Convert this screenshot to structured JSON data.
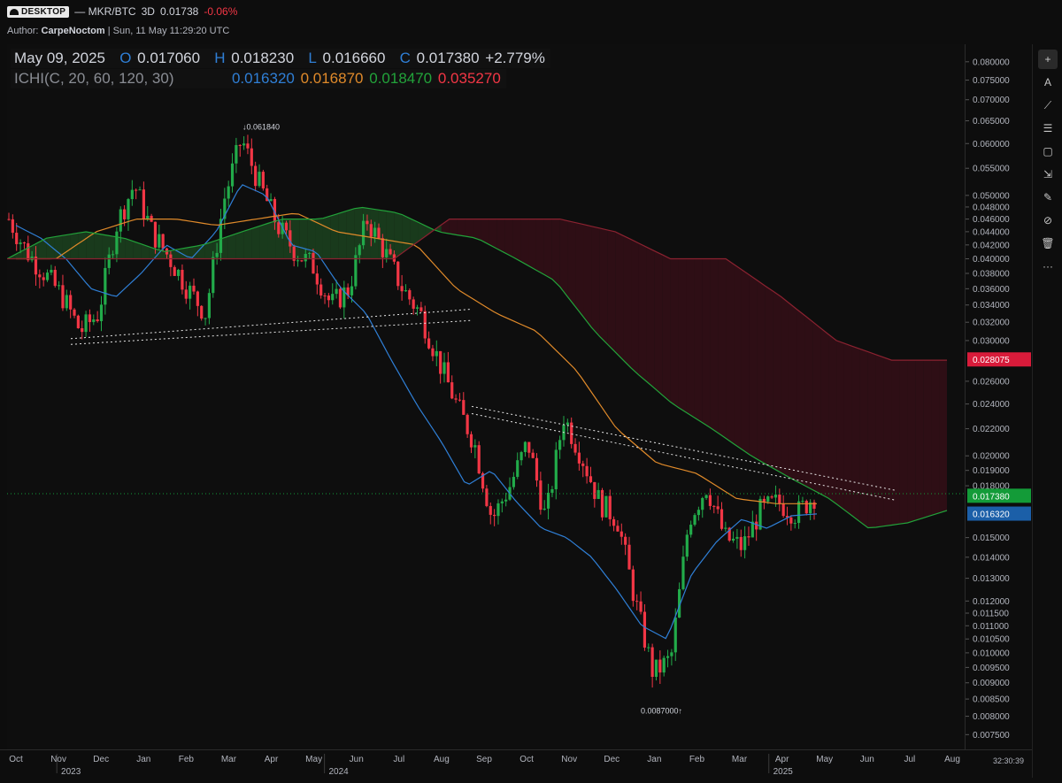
{
  "header": {
    "logo_label": "DESKTOP",
    "symbol": "— MKR/BTC",
    "interval": "3D",
    "last_price": "0.01738",
    "change": "-0.06%",
    "author_label": "Author:",
    "author_name": "CarpeNoctom",
    "timestamp": "| Sun, 11 May 11:29:20 UTC"
  },
  "legend": {
    "date": "May 09, 2025",
    "o_key": "O",
    "o_val": "0.017060",
    "h_key": "H",
    "h_val": "0.018230",
    "l_key": "L",
    "l_val": "0.016660",
    "c_key": "C",
    "c_val": "0.017380",
    "chg": "+2.779%",
    "indicator": "ICHI(C, 20, 60, 120, 30)",
    "ichi_vals": [
      "0.016320",
      "0.016870",
      "0.018470",
      "0.035270"
    ]
  },
  "colors": {
    "up": "#22ab4a",
    "down": "#f23645",
    "tenkan": "#2f7fd6",
    "kijun": "#e08a2a",
    "lead_a": "#22a33a",
    "lead_b": "#8b2230",
    "cloud_bull": "#1d4a22",
    "cloud_bear": "#3a0f18",
    "badge_green": "#139b38",
    "badge_blue": "#1b5fa8",
    "badge_red": "#d81b3a"
  },
  "chart_data": {
    "type": "candlestick",
    "title": "MKR/BTC 3D",
    "y_scale": "log",
    "ylim": [
      0.0073,
      0.083
    ],
    "y_ticks": [
      "0.080000",
      "0.075000",
      "0.070000",
      "0.065000",
      "0.060000",
      "0.055000",
      "0.050000",
      "0.048000",
      "0.046000",
      "0.044000",
      "0.042000",
      "0.040000",
      "0.038000",
      "0.036000",
      "0.034000",
      "0.032000",
      "0.030000",
      "0.026000",
      "0.024000",
      "0.022000",
      "0.020000",
      "0.019000",
      "0.018000",
      "0.015000",
      "0.014000",
      "0.013000",
      "0.012000",
      "0.011500",
      "0.011000",
      "0.010500",
      "0.010000",
      "0.009500",
      "0.009000",
      "0.008500",
      "0.008000",
      "0.007500"
    ],
    "x_ticks": [
      "Oct",
      "Nov",
      "Dec",
      "Jan",
      "Feb",
      "Mar",
      "Apr",
      "May",
      "Jun",
      "Jul",
      "Aug",
      "Sep",
      "Oct",
      "Nov",
      "Dec",
      "Jan",
      "Feb",
      "Mar",
      "Apr",
      "May",
      "Jun",
      "Jul",
      "Aug"
    ],
    "x_years": [
      {
        "label": "2023",
        "after": "Nov"
      },
      {
        "label": "2024",
        "after": "Jun"
      },
      {
        "label": "2025",
        "after": "Apr"
      }
    ],
    "close_path": [
      0.046,
      0.041,
      0.038,
      0.035,
      0.031,
      0.033,
      0.045,
      0.052,
      0.044,
      0.04,
      0.036,
      0.033,
      0.049,
      0.061,
      0.052,
      0.045,
      0.041,
      0.039,
      0.034,
      0.036,
      0.046,
      0.041,
      0.036,
      0.033,
      0.028,
      0.024,
      0.021,
      0.016,
      0.018,
      0.021,
      0.016,
      0.023,
      0.02,
      0.017,
      0.016,
      0.012,
      0.0093,
      0.0098,
      0.016,
      0.018,
      0.015,
      0.0145,
      0.0165,
      0.017,
      0.0163,
      0.01738
    ],
    "series": [
      {
        "name": "tenkan",
        "values": [
          0.045,
          0.043,
          0.04,
          0.036,
          0.035,
          0.038,
          0.042,
          0.04,
          0.044,
          0.052,
          0.05,
          0.042,
          0.041,
          0.036,
          0.033,
          0.028,
          0.024,
          0.021,
          0.018,
          0.019,
          0.017,
          0.0155,
          0.015,
          0.014,
          0.0125,
          0.011,
          0.0105,
          0.0132,
          0.0148,
          0.016,
          0.0155,
          0.0162,
          0.0163
        ]
      },
      {
        "name": "kijun",
        "values": [
          0.04,
          0.04,
          0.044,
          0.046,
          0.046,
          0.045,
          0.046,
          0.047,
          0.044,
          0.043,
          0.042,
          0.036,
          0.033,
          0.031,
          0.027,
          0.022,
          0.0195,
          0.0188,
          0.0172,
          0.0169,
          0.0169
        ]
      },
      {
        "name": "lead_a",
        "values": [
          0.04,
          0.043,
          0.044,
          0.043,
          0.041,
          0.042,
          0.044,
          0.046,
          0.046,
          0.048,
          0.047,
          0.044,
          0.043,
          0.04,
          0.037,
          0.031,
          0.027,
          0.024,
          0.022,
          0.02,
          0.0185,
          0.0172,
          0.0155,
          0.0158,
          0.0165
        ]
      },
      {
        "name": "lead_b",
        "values": [
          0.04,
          0.04,
          0.04,
          0.04,
          0.04,
          0.04,
          0.04,
          0.04,
          0.046,
          0.046,
          0.046,
          0.044,
          0.04,
          0.04,
          0.035,
          0.03,
          0.028,
          0.028
        ]
      }
    ],
    "annotations": [
      {
        "text": "↓0.061840",
        "value": 0.06184
      },
      {
        "text": "0.0087000↑",
        "value": 0.0087
      }
    ],
    "trendlines": [
      {
        "from": [
          "Nov 2023",
          0.0302
        ],
        "to": [
          "Sep 2024",
          0.0335
        ]
      },
      {
        "from": [
          "Nov 2023",
          0.0296
        ],
        "to": [
          "Sep 2024",
          0.0322
        ]
      },
      {
        "from": [
          "Sep 2024",
          0.0238
        ],
        "to": [
          "Jun 2025",
          0.0177
        ]
      },
      {
        "from": [
          "Sep 2024",
          0.0232
        ],
        "to": [
          "Jun 2025",
          0.0171
        ]
      }
    ],
    "price_labels": [
      {
        "text": "0.028075",
        "value": 0.028075,
        "color": "badge_red"
      },
      {
        "text": "0.017380",
        "value": 0.01738,
        "color": "badge_green"
      },
      {
        "text": "0.016320",
        "value": 0.01632,
        "color": "badge_blue"
      }
    ],
    "countdown": "32:30:39",
    "grid": false
  }
}
